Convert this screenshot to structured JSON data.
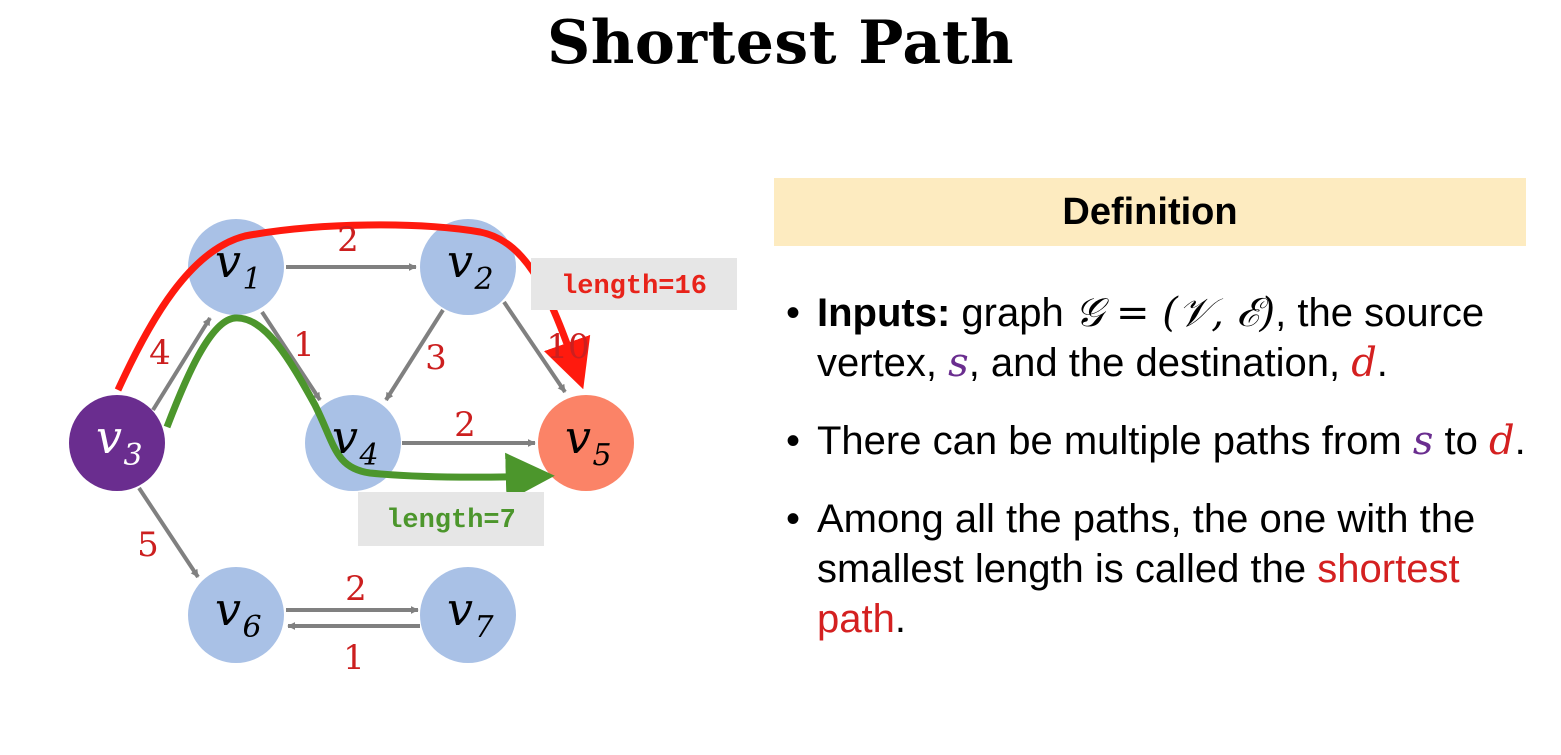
{
  "title": "Shortest Path",
  "colors": {
    "node": "#a9c1e6",
    "source_node": "#6a2d8f",
    "dest_node": "#fb8367",
    "edge": "#808080",
    "weight": "#cc1f1f",
    "red_path": "#ff1a0e",
    "green_path": "#4c962c",
    "header_bg": "#fdebc0"
  },
  "graph": {
    "nodes": [
      {
        "id": "v1",
        "base": "v",
        "sub": "1",
        "role": "normal"
      },
      {
        "id": "v2",
        "base": "v",
        "sub": "2",
        "role": "normal"
      },
      {
        "id": "v3",
        "base": "v",
        "sub": "3",
        "role": "source"
      },
      {
        "id": "v4",
        "base": "v",
        "sub": "4",
        "role": "normal"
      },
      {
        "id": "v5",
        "base": "v",
        "sub": "5",
        "role": "destination"
      },
      {
        "id": "v6",
        "base": "v",
        "sub": "6",
        "role": "normal"
      },
      {
        "id": "v7",
        "base": "v",
        "sub": "7",
        "role": "normal"
      }
    ],
    "edges": [
      {
        "from": "v1",
        "to": "v2",
        "weight": "2"
      },
      {
        "from": "v3",
        "to": "v1",
        "weight": "4"
      },
      {
        "from": "v1",
        "to": "v4",
        "weight": "1"
      },
      {
        "from": "v2",
        "to": "v4",
        "weight": "3"
      },
      {
        "from": "v2",
        "to": "v5",
        "weight": "10"
      },
      {
        "from": "v4",
        "to": "v5",
        "weight": "2"
      },
      {
        "from": "v3",
        "to": "v6",
        "weight": "5"
      },
      {
        "from": "v6",
        "to": "v7",
        "weight": "2"
      },
      {
        "from": "v7",
        "to": "v6",
        "weight": "1"
      }
    ],
    "paths": [
      {
        "name": "red",
        "nodes": [
          "v3",
          "v1",
          "v2",
          "v5"
        ],
        "label": "length=16"
      },
      {
        "name": "green",
        "nodes": [
          "v3",
          "v1",
          "v4",
          "v5"
        ],
        "label": "length=7"
      }
    ]
  },
  "definition": {
    "header": "Definition",
    "bullets": [
      {
        "bold": "Inputs:",
        "text1": " graph ",
        "math_graph": "𝒢 = (𝒱, ℰ)",
        "text2": ", the source vertex, ",
        "s": "s",
        "text3": ", and the destination, ",
        "d": "d",
        "text4": "."
      },
      {
        "text1": "There can be multiple paths from ",
        "s": "s",
        "text2": " to ",
        "d": "d",
        "text3": "."
      },
      {
        "text1": "Among all the paths, the one with the smallest length is called the ",
        "term": "shortest path",
        "text2": "."
      }
    ]
  }
}
